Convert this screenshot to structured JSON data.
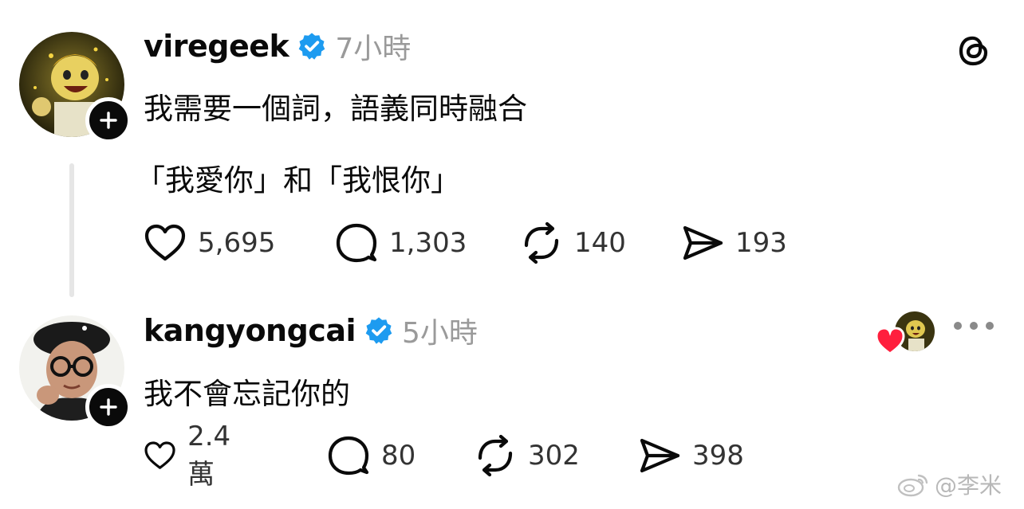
{
  "app": {
    "brand_icon": "threads-logo-icon"
  },
  "posts": [
    {
      "username": "viregeek",
      "verified": true,
      "time": "7小時",
      "lines": [
        "我需要一個詞，語義同時融合",
        "「我愛你」和「我恨你」"
      ],
      "stats": {
        "likes": "5,695",
        "replies": "1,303",
        "reposts": "140",
        "shares": "193"
      }
    },
    {
      "username": "kangyongcai",
      "verified": true,
      "time": "5小時",
      "lines": [
        "我不會忘記你的"
      ],
      "stats": {
        "likes": "2.4萬",
        "replies": "80",
        "reposts": "302",
        "shares": "398"
      }
    }
  ],
  "watermark": {
    "text": "@李米"
  },
  "colors": {
    "verified_blue": "#1d9bf0",
    "heart_red": "#ff1f3d",
    "text": "#0a0a0a",
    "muted": "#9a9a9a"
  }
}
